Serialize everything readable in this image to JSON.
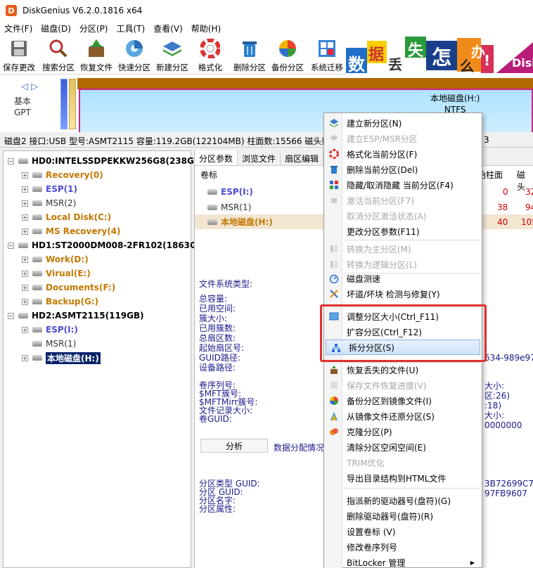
{
  "window": {
    "title": "DiskGenius V6.2.0.1816 x64",
    "icon": "D"
  },
  "menu": [
    "文件(F)",
    "磁盘(D)",
    "分区(P)",
    "工具(T)",
    "查看(V)",
    "帮助(H)"
  ],
  "toolbar": [
    {
      "label": "保存更改",
      "icon": "save-icon"
    },
    {
      "label": "搜索分区",
      "icon": "magnifier-icon"
    },
    {
      "label": "恢复文件",
      "icon": "recover-box-icon"
    },
    {
      "label": "快速分区",
      "icon": "quick-partition-icon"
    },
    {
      "label": "新建分区",
      "icon": "layers-icon"
    },
    {
      "label": "格式化",
      "icon": "lifebuoy-icon"
    },
    {
      "label": "删除分区",
      "icon": "trash-icon"
    },
    {
      "label": "备份分区",
      "icon": "pie-icon"
    },
    {
      "label": "系统迁移",
      "icon": "windows-icon"
    }
  ],
  "banner": {
    "chars": [
      "数",
      "据",
      "丢",
      "失",
      "怎",
      "么",
      "办",
      "!"
    ],
    "brand": "Disk"
  },
  "diskmap": {
    "arrows": "◁ ▷",
    "type_line1": "基本",
    "type_line2": "GPT",
    "partition_name": "本地磁盘(H:)",
    "partition_fs": "NTFS"
  },
  "disk_info": "磁盘2 接口:USB  型号:ASMT2115  容量:119.2GB(122104MB)  柱面数:15566  磁头数",
  "disk_info_tail": "3",
  "tree": [
    {
      "text": "HD0:INTELSSDPEKKW256G8(238GB)",
      "style": "hd",
      "level": 0
    },
    {
      "text": "Recovery(0)",
      "style": "orange",
      "level": 1
    },
    {
      "text": "ESP(1)",
      "style": "blue",
      "level": 1
    },
    {
      "text": "MSR(2)",
      "style": "gray",
      "level": 1
    },
    {
      "text": "Local Disk(C:)",
      "style": "orange",
      "level": 1
    },
    {
      "text": "MS Recovery(4)",
      "style": "orange",
      "level": 1
    },
    {
      "text": "HD1:ST2000DM008-2FR102(1863GB)",
      "style": "hd",
      "level": 0
    },
    {
      "text": "Work(D:)",
      "style": "orange",
      "level": 1
    },
    {
      "text": "Virual(E:)",
      "style": "orange",
      "level": 1
    },
    {
      "text": "Documents(F:)",
      "style": "orange",
      "level": 1
    },
    {
      "text": "Backup(G:)",
      "style": "orange",
      "level": 1
    },
    {
      "text": "HD2:ASMT2115(119GB)",
      "style": "hd",
      "level": 0
    },
    {
      "text": "ESP(I:)",
      "style": "blue",
      "level": 1
    },
    {
      "text": "MSR(1)",
      "style": "gray",
      "level": 1
    },
    {
      "text": "本地磁盘(H:)",
      "style": "selected",
      "level": 1
    }
  ],
  "right": {
    "tabs": [
      "分区参数",
      "浏览文件",
      "扇区编辑"
    ],
    "col_label": "卷标",
    "col_start_cyl": "始柱面",
    "col_head": "磁头",
    "partitions": [
      {
        "name": "ESP(I:)",
        "style": "blue",
        "cyl": "0",
        "head": "32"
      },
      {
        "name": "MSR(1)",
        "style": "gray",
        "cyl": "38",
        "head": "94"
      },
      {
        "name": "本地磁盘(H:)",
        "style": "orange",
        "cyl": "40",
        "head": "105"
      }
    ],
    "fs_type_label": "文件系统类型:",
    "fields_a": [
      "总容量:",
      "已用空间:",
      "簇大小:",
      "已用簇数:",
      "总扇区数:",
      "起始扇区号:",
      "GUID路径:",
      "设备路径:"
    ],
    "fields_b": [
      "卷序列号:",
      "$MFT簇号:",
      "$MFTMirr簇号:",
      "文件记录大小:",
      "卷GUID:"
    ],
    "analyze_button": "分析",
    "alloc_label": "数据分配情况",
    "fields_c": [
      "分区类型 GUID:",
      "分区 GUID:",
      "分区名字:",
      "分区属性:"
    ],
    "tail_values": {
      "guid_path": "634-989e97",
      "b1": "大小:",
      "b2": "区:26)",
      "b3": ":18)",
      "b4": "大小:",
      "b5": "0000000",
      "c1": "3B72699C7",
      "c2": "97FB9607"
    }
  },
  "context_menu": {
    "items": [
      {
        "label": "建立新分区(N)",
        "icon": "layers-icon",
        "disabled": false
      },
      {
        "label": "建立ESP/MSR分区",
        "icon": "esp-icon",
        "disabled": true
      },
      {
        "label": "格式化当前分区(F)",
        "icon": "lifebuoy-icon",
        "disabled": false
      },
      {
        "label": "删除当前分区(Del)",
        "icon": "trash-icon",
        "disabled": false
      },
      {
        "label": "隐藏/取消隐藏 当前分区(F4)",
        "icon": "hide-icon",
        "disabled": false
      },
      {
        "label": "激活当前分区(F7)",
        "icon": "activate-icon",
        "disabled": true
      },
      {
        "label": "取消分区激活状态(A)",
        "icon": "",
        "disabled": true
      },
      {
        "label": "更改分区参数(F11)",
        "icon": "",
        "disabled": false
      },
      {
        "label": "转换为主分区(M)",
        "icon": "convert-icon",
        "disabled": true
      },
      {
        "label": "转换为逻辑分区(L)",
        "icon": "convert-icon",
        "disabled": true
      },
      {
        "label": "磁盘测速",
        "icon": "speed-icon",
        "disabled": false
      },
      {
        "label": "坏道/坏块 检测与修复(Y)",
        "icon": "tools-icon",
        "disabled": false
      },
      {
        "label": "调整分区大小(Ctrl_F11)",
        "icon": "resize-icon",
        "disabled": false
      },
      {
        "label": "扩容分区(Ctrl_F12)",
        "icon": "",
        "disabled": false
      },
      {
        "label": "拆分分区(S)",
        "icon": "split-icon",
        "disabled": false
      },
      {
        "label": "恢复丢失的文件(U)",
        "icon": "recover-box-icon",
        "disabled": false
      },
      {
        "label": "保存文件恢复进度(V)",
        "icon": "save-progress-icon",
        "disabled": true
      },
      {
        "label": "备份分区到镜像文件(I)",
        "icon": "pie-icon",
        "disabled": false
      },
      {
        "label": "从镜像文件还原分区(S)",
        "icon": "restore-icon",
        "disabled": false
      },
      {
        "label": "克隆分区(P)",
        "icon": "clone-icon",
        "disabled": false
      },
      {
        "label": "清除分区空闲空间(E)",
        "icon": "",
        "disabled": false
      },
      {
        "label": "TRIM优化",
        "icon": "",
        "disabled": true
      },
      {
        "label": "导出目录结构到HTML文件",
        "icon": "",
        "disabled": false
      },
      {
        "label": "指派新的驱动器号(盘符)(G)",
        "icon": "",
        "disabled": false
      },
      {
        "label": "删除驱动器号(盘符)(R)",
        "icon": "",
        "disabled": false
      },
      {
        "label": "设置卷标 (V)",
        "icon": "",
        "disabled": false
      },
      {
        "label": "修改卷序列号",
        "icon": "",
        "disabled": false
      },
      {
        "label": "BitLocker 管理",
        "icon": "",
        "disabled": false
      }
    ],
    "highlighted": "拆分分区(S)"
  },
  "colors": {
    "highlight_box": "#e03030",
    "partition_border": "#d0218d",
    "selected_tree": "#0a246a",
    "orange_partition": "#c47800",
    "blue_partition": "#4a4ad6"
  }
}
